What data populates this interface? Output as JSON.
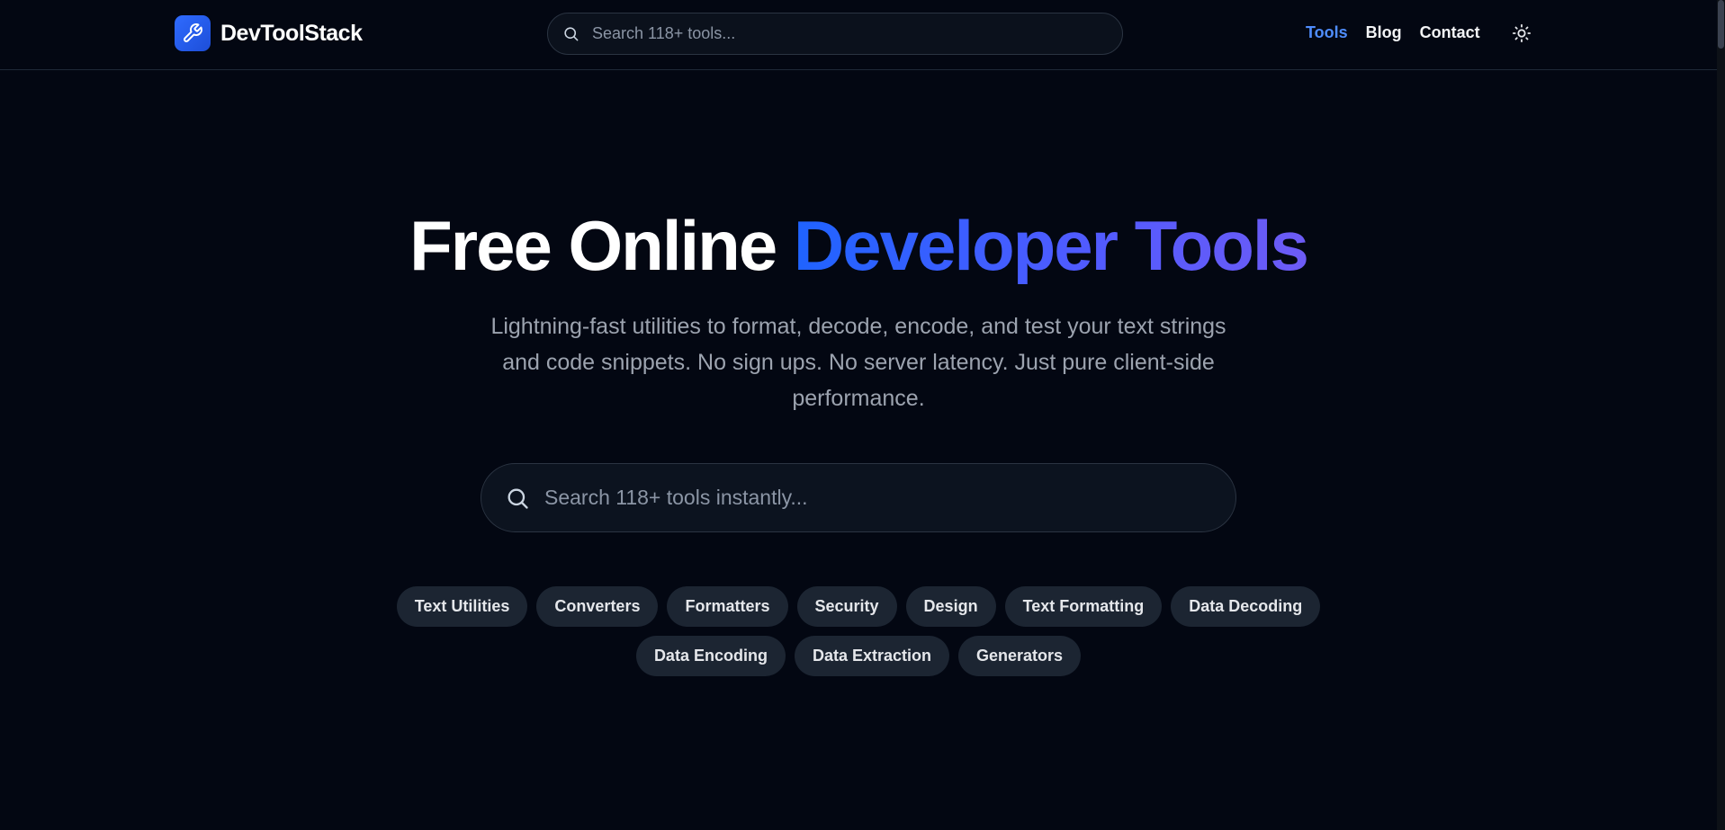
{
  "header": {
    "brand_name": "DevToolStack",
    "search_placeholder": "Search 118+ tools...",
    "nav": [
      {
        "label": "Tools",
        "active": true
      },
      {
        "label": "Blog",
        "active": false
      },
      {
        "label": "Contact",
        "active": false
      }
    ],
    "theme_icon": "sun-icon"
  },
  "hero": {
    "title_plain": "Free Online ",
    "title_highlight": "Developer Tools",
    "subtitle": "Lightning-fast utilities to format, decode, encode, and test your text strings and code snippets. No sign ups. No server latency. Just pure client-side performance.",
    "search_placeholder": "Search 118+ tools instantly..."
  },
  "categories": [
    "Text Utilities",
    "Converters",
    "Formatters",
    "Security",
    "Design",
    "Text Formatting",
    "Data Decoding",
    "Data Encoding",
    "Data Extraction",
    "Generators"
  ],
  "colors": {
    "background": "#030712",
    "accent": "#1f63ff",
    "accent_secondary": "#6d5bf5",
    "nav_active": "#4f8dfd",
    "chip_bg": "#1c2532"
  }
}
